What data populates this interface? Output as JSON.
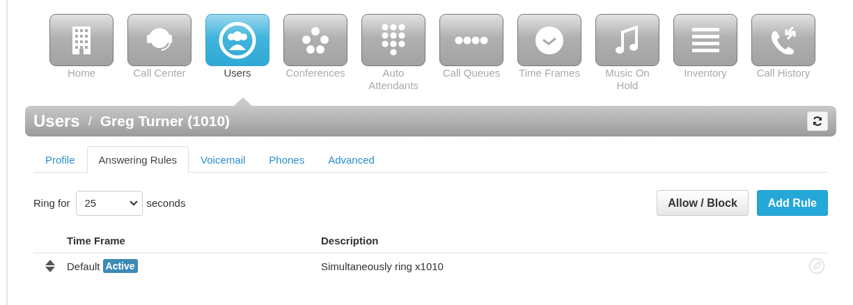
{
  "nav": [
    {
      "label": "Home",
      "kind": "building",
      "selected": false
    },
    {
      "label": "Call Center",
      "kind": "headset",
      "selected": false
    },
    {
      "label": "Users",
      "kind": "users",
      "selected": true
    },
    {
      "label": "Conferences",
      "kind": "dots5",
      "selected": false
    },
    {
      "label": "Auto Attendants",
      "kind": "keypad",
      "selected": false
    },
    {
      "label": "Call Queues",
      "kind": "dots4",
      "selected": false
    },
    {
      "label": "Time Frames",
      "kind": "clock",
      "selected": false
    },
    {
      "label": "Music On Hold",
      "kind": "note",
      "selected": false
    },
    {
      "label": "Inventory",
      "kind": "lines",
      "selected": false
    },
    {
      "label": "Call History",
      "kind": "phone",
      "selected": false
    }
  ],
  "header": {
    "section": "Users",
    "separator": "/",
    "title": "Greg Turner (1010)"
  },
  "tabs": [
    {
      "label": "Profile",
      "selected": false
    },
    {
      "label": "Answering Rules",
      "selected": true
    },
    {
      "label": "Voicemail",
      "selected": false
    },
    {
      "label": "Phones",
      "selected": false
    },
    {
      "label": "Advanced",
      "selected": false
    }
  ],
  "ring": {
    "prefix": "Ring for",
    "value": "25",
    "suffix": "seconds"
  },
  "buttons": [
    {
      "label": "Allow / Block",
      "kind": "default"
    },
    {
      "label": "Add Rule",
      "kind": "primary"
    }
  ],
  "table": {
    "columns": [
      "Time Frame",
      "Description"
    ],
    "rows": [
      {
        "time_frame": "Default",
        "badge": "Active",
        "description": "Simultaneously ring x1010"
      }
    ]
  }
}
